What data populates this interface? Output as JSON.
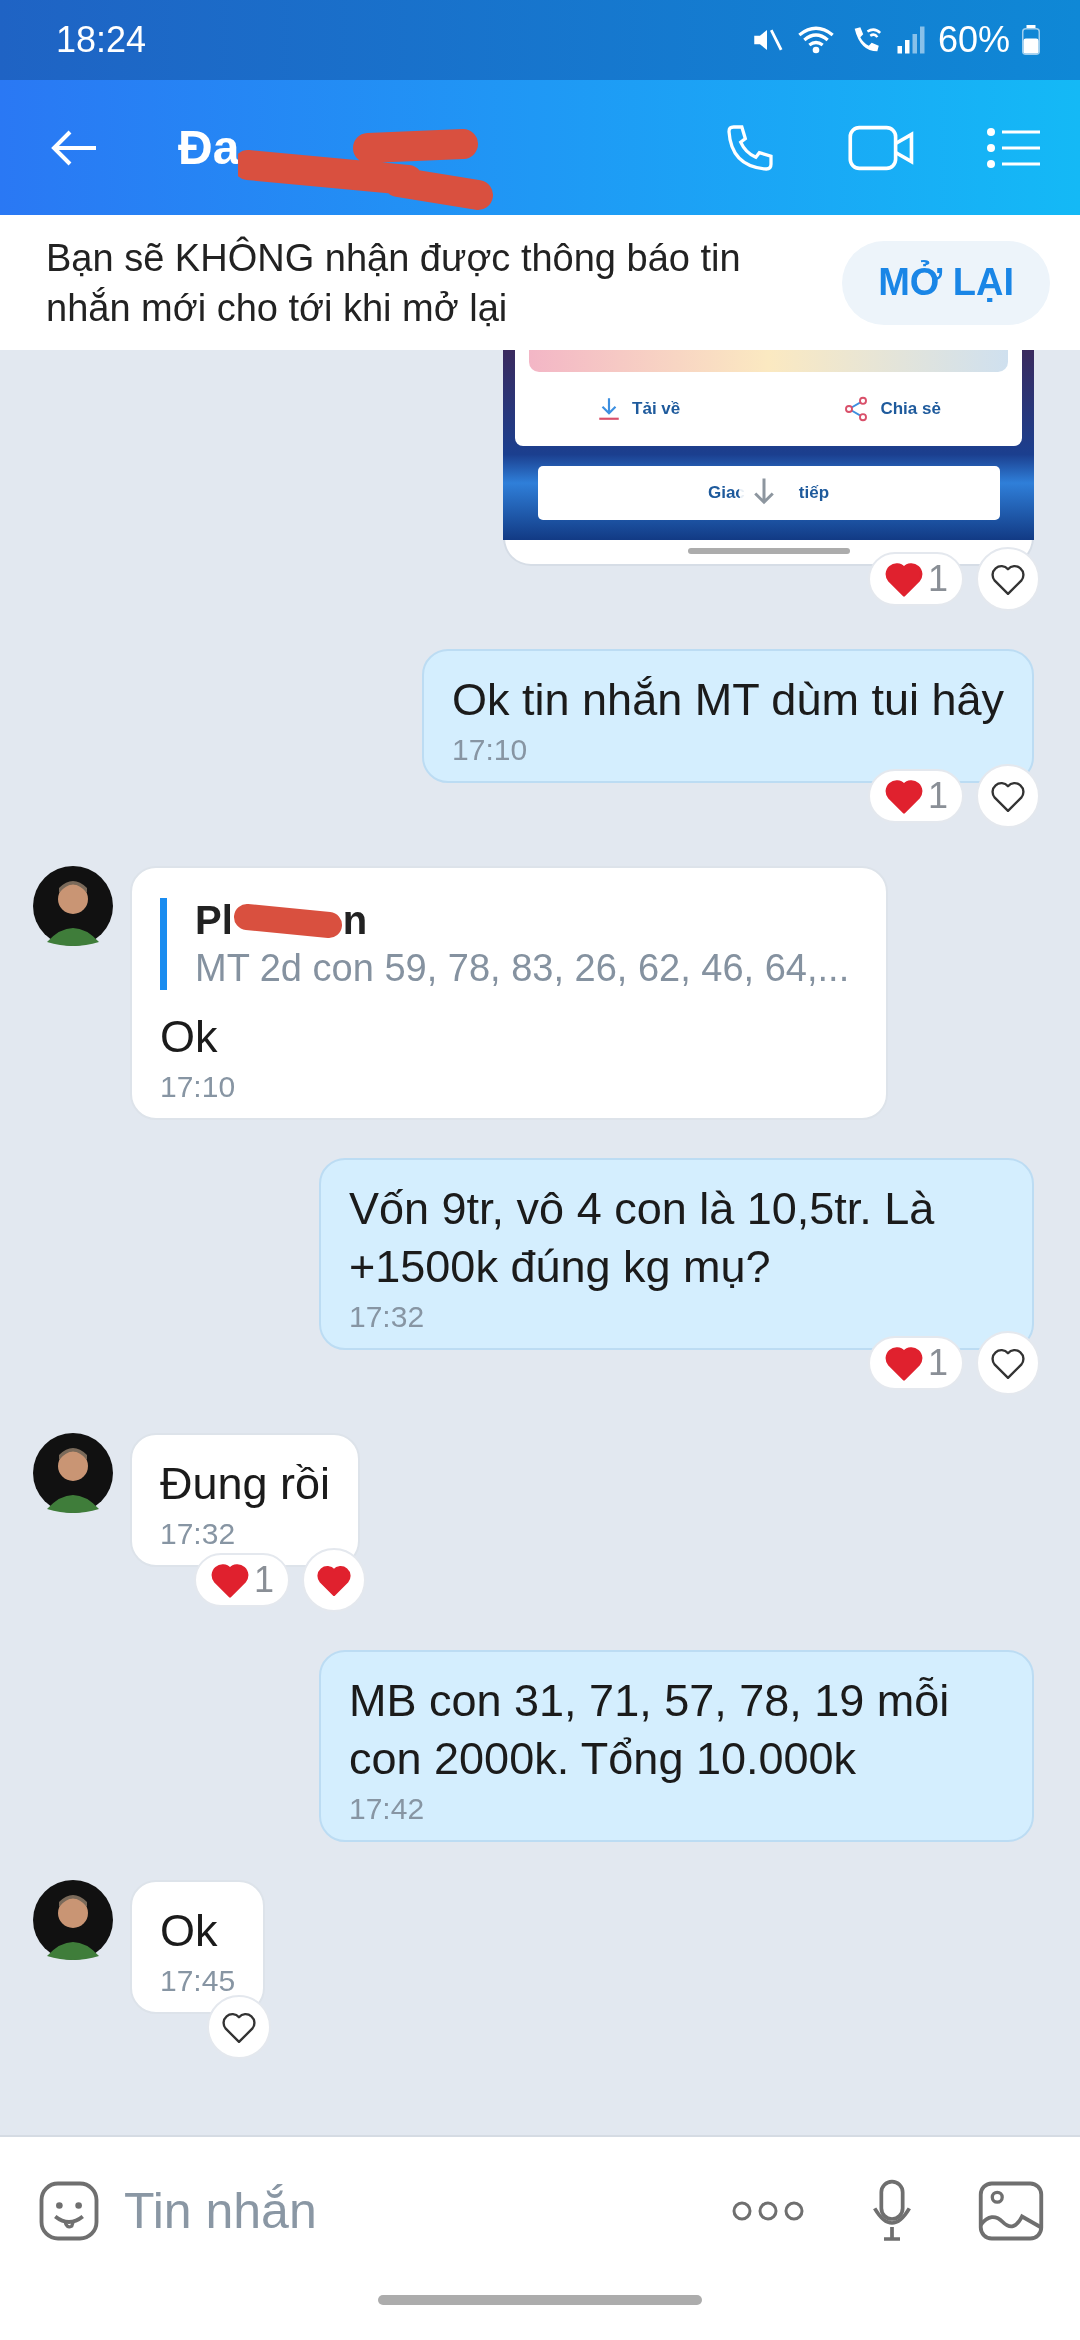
{
  "status_bar": {
    "time": "18:24",
    "battery": "60%"
  },
  "header": {
    "title": "Đa"
  },
  "mute_banner": {
    "text": "Bạn sẽ KHÔNG nhận được thông báo tin nhắn mới cho tới khi mở lại",
    "button": "MỞ LẠI"
  },
  "messages": [
    {
      "kind": "image",
      "outgoing": true,
      "shared": {
        "download": "Tải về",
        "share": "Chia sẻ",
        "button_start": "Giac",
        "button_end": "tiếp"
      },
      "reactions": {
        "count": "1",
        "liked": false
      }
    },
    {
      "kind": "text",
      "outgoing": true,
      "text": "Ok tin nhắn MT dùm tui hây",
      "time": "17:10",
      "reactions": {
        "count": "1",
        "liked": false
      }
    },
    {
      "kind": "reply",
      "outgoing": false,
      "quote": {
        "sender_start": "Pl",
        "sender_end": "n",
        "text": "MT 2d con 59, 78, 83, 26, 62, 46, 64,..."
      },
      "text": "Ok",
      "time": "17:10"
    },
    {
      "kind": "text",
      "outgoing": true,
      "text": "Vốn 9tr, vô 4 con là 10,5tr. Là +1500k đúng kg mụ?",
      "time": "17:32",
      "reactions": {
        "count": "1",
        "liked": false
      }
    },
    {
      "kind": "text",
      "outgoing": false,
      "text": "Đung rồi",
      "time": "17:32",
      "reactions": {
        "count": "1",
        "liked": true
      }
    },
    {
      "kind": "text",
      "outgoing": true,
      "text": "MB con 31, 71, 57, 78, 19 mỗi con 2000k. Tổng 10.000k",
      "time": "17:42"
    },
    {
      "kind": "text",
      "outgoing": false,
      "text": "Ok",
      "time": "17:45",
      "reactions": {
        "liked": false
      }
    }
  ],
  "composer": {
    "placeholder": "Tin nhắn"
  }
}
